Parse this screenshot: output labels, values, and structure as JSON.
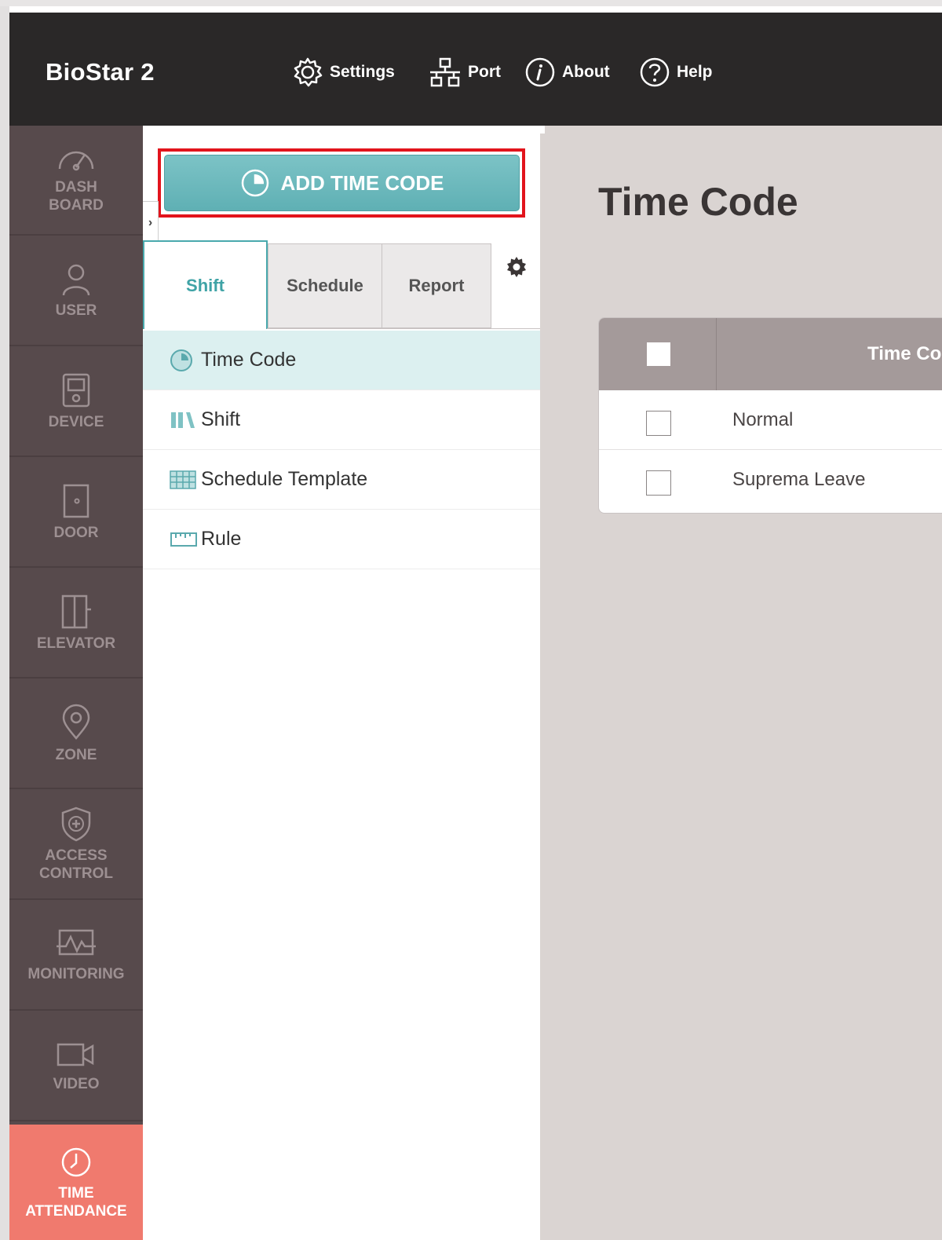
{
  "header": {
    "brand": "BioStar 2",
    "nav": [
      {
        "label": "Settings",
        "icon": "gear-icon"
      },
      {
        "label": "Port",
        "icon": "network-icon"
      },
      {
        "label": "About",
        "icon": "info-icon"
      },
      {
        "label": "Help",
        "icon": "help-icon"
      }
    ]
  },
  "sidebar": {
    "items": [
      {
        "label": "DASH\nBOARD",
        "icon": "dashboard-gauge-icon"
      },
      {
        "label": "USER",
        "icon": "user-icon"
      },
      {
        "label": "DEVICE",
        "icon": "device-icon"
      },
      {
        "label": "DOOR",
        "icon": "door-icon"
      },
      {
        "label": "ELEVATOR",
        "icon": "elevator-icon"
      },
      {
        "label": "ZONE",
        "icon": "location-pin-icon"
      },
      {
        "label": "ACCESS\nCONTROL",
        "icon": "shield-plus-icon"
      },
      {
        "label": "MONITORING",
        "icon": "monitor-pulse-icon"
      },
      {
        "label": "VIDEO",
        "icon": "video-camera-icon"
      },
      {
        "label": "TIME\nATTENDANCE",
        "icon": "clock-icon",
        "active": true
      }
    ]
  },
  "panel": {
    "add_button_label": "ADD TIME CODE",
    "collapse_glyph": "›",
    "tabs": [
      {
        "label": "Shift",
        "active": true
      },
      {
        "label": "Schedule"
      },
      {
        "label": "Report"
      }
    ],
    "menu": [
      {
        "label": "Time Code",
        "icon": "time-code-icon",
        "selected": true
      },
      {
        "label": "Shift",
        "icon": "shift-icon"
      },
      {
        "label": "Schedule Template",
        "icon": "schedule-template-icon"
      },
      {
        "label": "Rule",
        "icon": "ruler-icon"
      }
    ]
  },
  "main": {
    "title": "Time Code",
    "table": {
      "column_header": "Time Code",
      "rows": [
        {
          "name": "Normal"
        },
        {
          "name": "Suprema Leave"
        }
      ]
    }
  },
  "colors": {
    "header_bg": "#2a2828",
    "rail_bg": "#574a4c",
    "rail_active": "#f07a6e",
    "accent_teal": "#5fb0b4",
    "highlight_red": "#e2141c",
    "main_bg": "#dad4d2"
  }
}
